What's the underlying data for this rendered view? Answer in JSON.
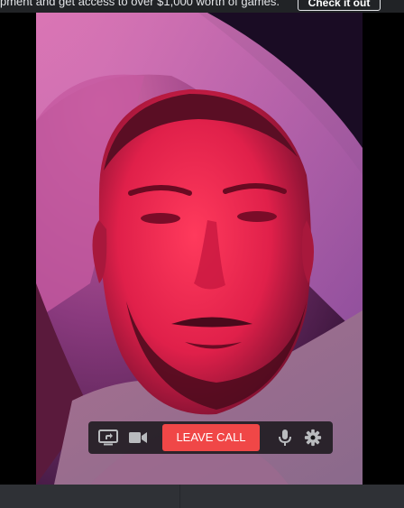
{
  "promo": {
    "text": "pment and get access to over $1,000 worth of games.",
    "button_label": "Check it out"
  },
  "call_controls": {
    "leave_label": "LEAVE CALL",
    "icons": [
      "screen-share-icon",
      "video-camera-icon",
      "microphone-icon",
      "gear-icon"
    ]
  },
  "colors": {
    "leave_button": "#f04747",
    "controls_bg": "#141416",
    "bottom_bar": "#2f3136"
  }
}
